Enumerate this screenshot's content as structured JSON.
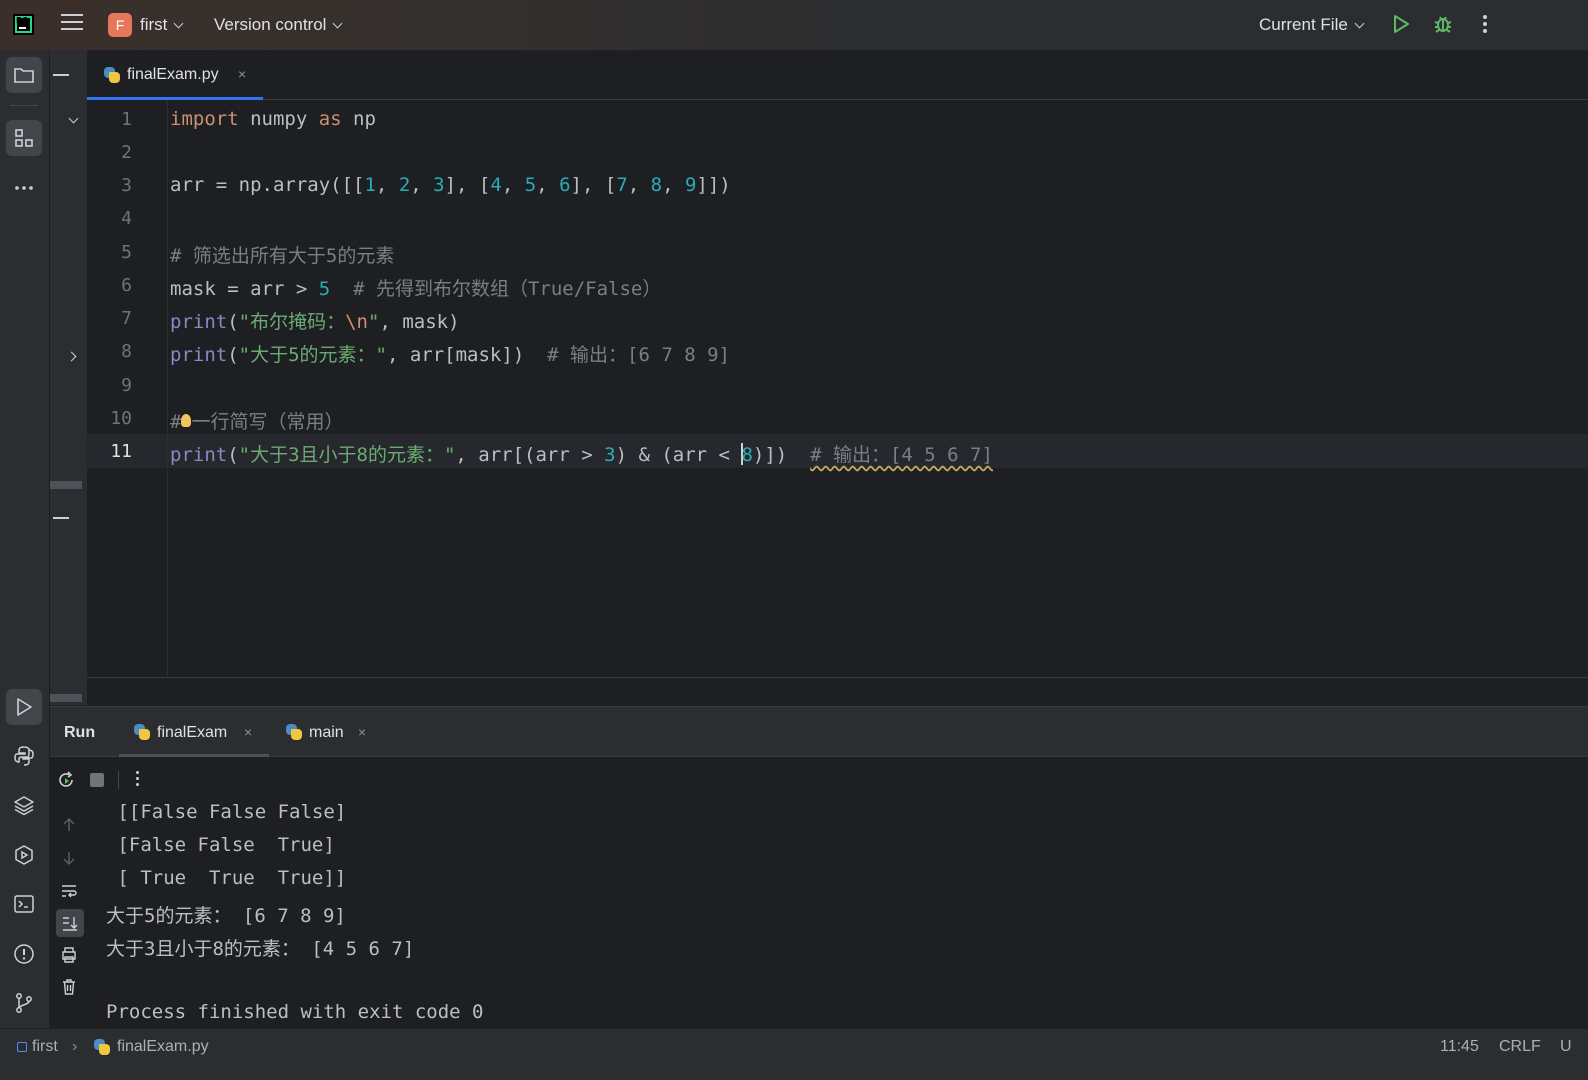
{
  "titlebar": {
    "project_initial": "F",
    "project_name": "first",
    "vcs_label": "Version control",
    "run_config": "Current File",
    "accent_color": "#e5775a"
  },
  "left_toolbar": {
    "icons": [
      "folder-icon",
      "structure-icon",
      "more-icon",
      "run-icon",
      "python-console-icon",
      "layers-icon",
      "services-icon",
      "terminal-icon",
      "problems-icon",
      "git-icon"
    ]
  },
  "editor": {
    "tab_name": "finalExam.py",
    "tab_close": "×",
    "line_numbers": [
      "1",
      "2",
      "3",
      "4",
      "5",
      "6",
      "7",
      "8",
      "9",
      "10",
      "11"
    ]
  },
  "run_panel": {
    "title": "Run",
    "tabs": [
      {
        "label": "finalExam",
        "close": "×"
      },
      {
        "label": "main",
        "close": "×"
      }
    ],
    "console_lines": [
      " [[False False False]",
      " [False False  True]",
      " [ True  True  True]]",
      "大于5的元素： [6 7 8 9]",
      "大于3且小于8的元素： [4 5 6 7]",
      "",
      "Process finished with exit code 0"
    ]
  },
  "statusbar": {
    "project": "first",
    "file": "finalExam.py",
    "position": "11:45",
    "line_ending": "CRLF",
    "encoding_partial": "U"
  }
}
